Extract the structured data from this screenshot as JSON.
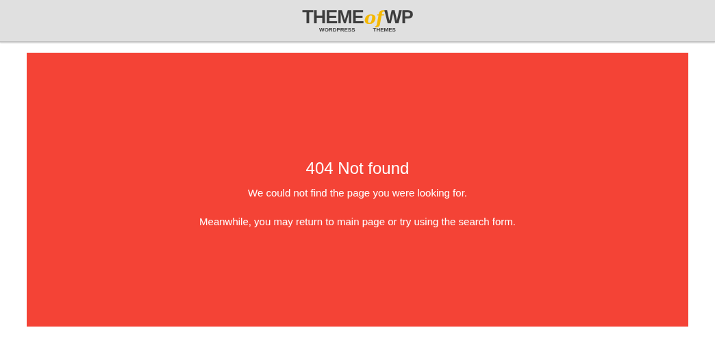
{
  "header": {
    "logo": {
      "word_1": "THEME",
      "word_2": "of",
      "word_3": "WP",
      "tagline_1": "WORDPRESS",
      "tagline_2": "THEMES"
    }
  },
  "error_panel": {
    "title": "404 Not found",
    "message": "We could not find the page you were looking for.",
    "hint": "Meanwhile, you may return to main page or try using the search form."
  }
}
